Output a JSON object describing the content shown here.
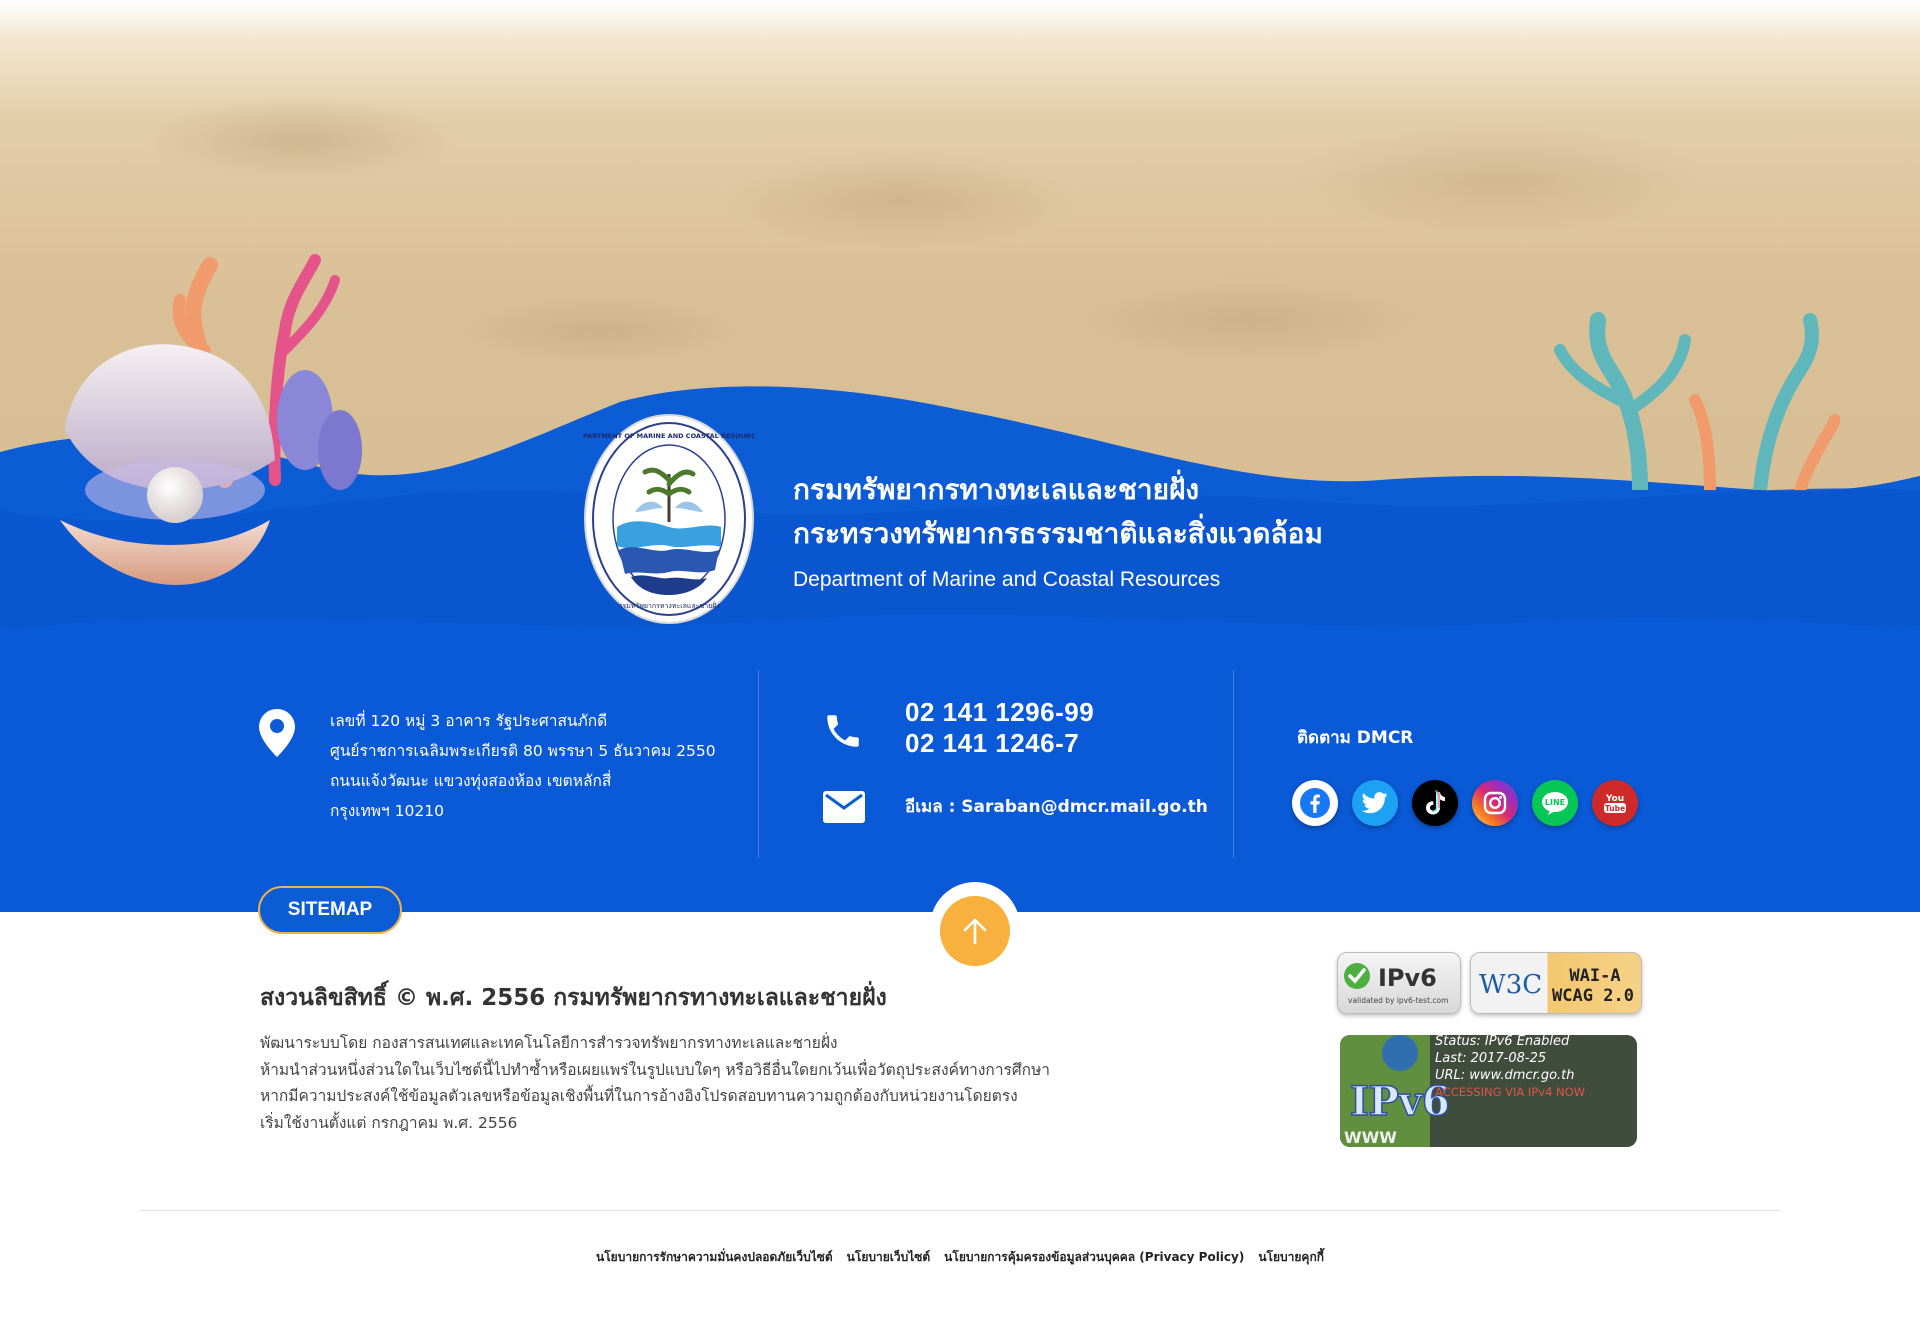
{
  "header": {
    "title_th_1": "กรมทรัพยากรทางทะเลและชายฝั่ง",
    "title_th_2": "กระทรวงทรัพยากรธรรมชาติและสิ่งแวดล้อม",
    "title_en": "Department of Marine and Coastal Resources",
    "logo_text_top": "DEPARTMENT OF MARINE AND COASTAL RESOURCES",
    "logo_text_bottom": "กรมทรัพยากรทางทะเลและชายฝั่ง"
  },
  "contact": {
    "address_lines": [
      "เลขที่ 120 หมู่ 3 อาคาร รัฐประศาสนภักดี",
      "ศูนย์ราชการเฉลิมพระเกียรติ 80 พรรษา 5 ธันวาคม 2550",
      "ถนนแจ้งวัฒนะ แขวงทุ่งสองห้อง เขตหลักสี่",
      "กรุงเทพฯ 10210"
    ],
    "phones": [
      "02 141 1296-99",
      "02 141 1246-7"
    ],
    "email": "อีเมล : Saraban@dmcr.mail.go.th",
    "follow_label": "ติดตาม DMCR",
    "social_icons": [
      "facebook-icon",
      "twitter-icon",
      "tiktok-icon",
      "instagram-icon",
      "line-icon",
      "youtube-icon"
    ]
  },
  "footer": {
    "sitemap_label": "SITEMAP",
    "copyright": "สงวนลิขสิทธิ์ © พ.ศ. 2556 กรมทรัพยากรทางทะเลและชายฝั่ง",
    "dev_lines": [
      "พัฒนาระบบโดย กองสารสนเทศและเทคโนโลยีการสำรวจทรัพยากรทางทะเลและชายฝั่ง",
      "ห้ามนำส่วนหนึ่งส่วนใดในเว็บไซต์นี้ไปทำซ้ำหรือเผยแพร่ในรูปแบบใดๆ หรือวิธีอื่นใดยกเว้นเพื่อวัตถุประสงค์ทางการศึกษา",
      "หากมีความประสงค์ใช้ข้อมูลตัวเลขหรือข้อมูลเชิงพื้นที่ในการอ้างอิงโปรดสอบทานความถูกต้องกับหน่วยงานโดยตรง",
      "เริ่มใช้งานตั้งแต่ กรกฎาคม พ.ศ. 2556"
    ],
    "badges": {
      "ipv6_label": "IPv6",
      "ipv6_sub": "validated by ipv6-test.com",
      "w3c_label": "W3C",
      "wai_label": "WAI-A",
      "wcag_label": "WCAG 2.0",
      "status_lines": [
        "Status: IPv6 Enabled",
        "Last: 2017-08-25",
        "URL: www.dmcr.go.th",
        "ACCESSING VIA IPv4 NOW"
      ],
      "ipv6_logo_text": "IPv6",
      "www_text": "WWW"
    },
    "policies": [
      "นโยบายการรักษาความมั่นคงปลอดภัยเว็บไซต์",
      "นโยบายเว็บไซต์",
      "นโยบายการคุ้มครองข้อมูลส่วนบุคคล (Privacy Policy)",
      "นโยบายคุกกี้"
    ]
  },
  "colors": {
    "primary_blue": "#0b5cd5",
    "deep_blue": "#0a52cc",
    "accent_orange": "#f8b13f",
    "sand": "#d9bf96"
  }
}
